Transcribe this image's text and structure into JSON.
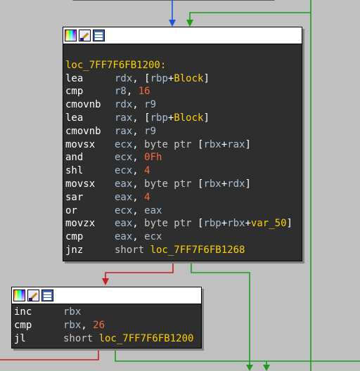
{
  "node_a": {
    "label": "loc_7FF7F6FB1200:",
    "rows": [
      {
        "mnemonic": "lea",
        "ops": [
          {
            "t": "reg",
            "v": "rdx"
          },
          {
            "t": "txt",
            "v": ", ["
          },
          {
            "t": "reg",
            "v": "rbp"
          },
          {
            "t": "txt",
            "v": "+"
          },
          {
            "t": "sym",
            "v": "Block"
          },
          {
            "t": "txt",
            "v": "]"
          }
        ]
      },
      {
        "mnemonic": "cmp",
        "ops": [
          {
            "t": "reg",
            "v": "r8"
          },
          {
            "t": "txt",
            "v": ", "
          },
          {
            "t": "num",
            "v": "16"
          }
        ]
      },
      {
        "mnemonic": "cmovnb",
        "ops": [
          {
            "t": "reg",
            "v": "rdx"
          },
          {
            "t": "txt",
            "v": ", "
          },
          {
            "t": "reg",
            "v": "r9"
          }
        ]
      },
      {
        "mnemonic": "lea",
        "ops": [
          {
            "t": "reg",
            "v": "rax"
          },
          {
            "t": "txt",
            "v": ", ["
          },
          {
            "t": "reg",
            "v": "rbp"
          },
          {
            "t": "txt",
            "v": "+"
          },
          {
            "t": "sym",
            "v": "Block"
          },
          {
            "t": "txt",
            "v": "]"
          }
        ]
      },
      {
        "mnemonic": "cmovnb",
        "ops": [
          {
            "t": "reg",
            "v": "rax"
          },
          {
            "t": "txt",
            "v": ", "
          },
          {
            "t": "reg",
            "v": "r9"
          }
        ]
      },
      {
        "mnemonic": "movsx",
        "ops": [
          {
            "t": "reg",
            "v": "ecx"
          },
          {
            "t": "txt",
            "v": ", "
          },
          {
            "t": "gray",
            "v": "byte ptr"
          },
          {
            "t": "txt",
            "v": " ["
          },
          {
            "t": "reg",
            "v": "rbx"
          },
          {
            "t": "txt",
            "v": "+"
          },
          {
            "t": "reg",
            "v": "rax"
          },
          {
            "t": "txt",
            "v": "]"
          }
        ]
      },
      {
        "mnemonic": "and",
        "ops": [
          {
            "t": "reg",
            "v": "ecx"
          },
          {
            "t": "txt",
            "v": ", "
          },
          {
            "t": "num",
            "v": "0Fh"
          }
        ]
      },
      {
        "mnemonic": "shl",
        "ops": [
          {
            "t": "reg",
            "v": "ecx"
          },
          {
            "t": "txt",
            "v": ", "
          },
          {
            "t": "num",
            "v": "4"
          }
        ]
      },
      {
        "mnemonic": "movsx",
        "ops": [
          {
            "t": "reg",
            "v": "eax"
          },
          {
            "t": "txt",
            "v": ", "
          },
          {
            "t": "gray",
            "v": "byte ptr"
          },
          {
            "t": "txt",
            "v": " ["
          },
          {
            "t": "reg",
            "v": "rbx"
          },
          {
            "t": "txt",
            "v": "+"
          },
          {
            "t": "reg",
            "v": "rdx"
          },
          {
            "t": "txt",
            "v": "]"
          }
        ]
      },
      {
        "mnemonic": "sar",
        "ops": [
          {
            "t": "reg",
            "v": "eax"
          },
          {
            "t": "txt",
            "v": ", "
          },
          {
            "t": "num",
            "v": "4"
          }
        ]
      },
      {
        "mnemonic": "or",
        "ops": [
          {
            "t": "reg",
            "v": "ecx"
          },
          {
            "t": "txt",
            "v": ", "
          },
          {
            "t": "reg",
            "v": "eax"
          }
        ]
      },
      {
        "mnemonic": "movzx",
        "ops": [
          {
            "t": "reg",
            "v": "eax"
          },
          {
            "t": "txt",
            "v": ", "
          },
          {
            "t": "gray",
            "v": "byte ptr"
          },
          {
            "t": "txt",
            "v": " ["
          },
          {
            "t": "reg",
            "v": "rbp"
          },
          {
            "t": "txt",
            "v": "+"
          },
          {
            "t": "reg",
            "v": "rbx"
          },
          {
            "t": "txt",
            "v": "+"
          },
          {
            "t": "sym",
            "v": "var_50"
          },
          {
            "t": "txt",
            "v": "]"
          }
        ]
      },
      {
        "mnemonic": "cmp",
        "ops": [
          {
            "t": "reg",
            "v": "eax"
          },
          {
            "t": "txt",
            "v": ", "
          },
          {
            "t": "reg",
            "v": "ecx"
          }
        ]
      },
      {
        "mnemonic": "jnz",
        "ops": [
          {
            "t": "gray",
            "v": "short "
          },
          {
            "t": "sym",
            "v": "loc_7FF7F6FB1268"
          }
        ]
      }
    ]
  },
  "node_b": {
    "rows": [
      {
        "mnemonic": "inc",
        "ops": [
          {
            "t": "reg",
            "v": "rbx"
          }
        ]
      },
      {
        "mnemonic": "cmp",
        "ops": [
          {
            "t": "reg",
            "v": "rbx"
          },
          {
            "t": "txt",
            "v": ", "
          },
          {
            "t": "num",
            "v": "26"
          }
        ]
      },
      {
        "mnemonic": "jl",
        "ops": [
          {
            "t": "gray",
            "v": "short "
          },
          {
            "t": "sym",
            "v": "loc_7FF7F6FB1200"
          }
        ]
      }
    ]
  },
  "colors": {
    "background": "#c0c0c0",
    "node_bg": "#2e2e2e",
    "edge_normal": "#1a56e0",
    "edge_true": "#1a9e1a",
    "edge_false": "#c81e1e",
    "label": "#ffd000",
    "register": "#a8c0d8",
    "number": "#ff6a3a"
  },
  "toolbar_icons": [
    "color-palette-icon",
    "rename-icon",
    "graph-icon"
  ]
}
